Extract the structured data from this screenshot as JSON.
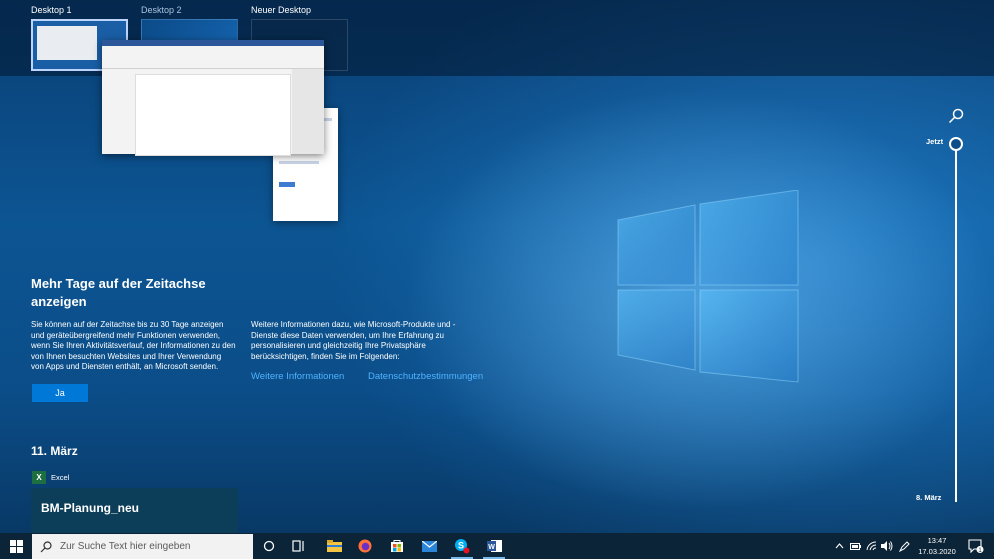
{
  "desktops": [
    {
      "label": "Desktop 1"
    },
    {
      "label": "Desktop 2"
    },
    {
      "label": "Neuer Desktop"
    }
  ],
  "timeline_prompt": {
    "title": "Mehr Tage auf der Zeitachse anzeigen",
    "description": "Sie können auf der Zeitachse bis zu 30 Tage anzeigen und geräteübergreifend mehr Funktionen verwenden, wenn Sie Ihren Aktivitätsverlauf, der Informationen zu den von Ihnen besuchten Websites und Ihrer Verwendung von Apps und Diensten enthält, an Microsoft senden.",
    "info": "Weitere Informationen dazu, wie Microsoft-Produkte und -Dienste diese Daten verwenden, um Ihre Erfahrung zu personalisieren und gleichzeitig Ihre Privatsphäre berücksichtigen, finden Sie im Folgenden:",
    "yes_label": "Ja",
    "more_info_link": "Weitere Informationen",
    "privacy_link": "Datenschutzbestimmungen"
  },
  "day_section": {
    "heading": "11. März",
    "app_name": "Excel",
    "activity_title": "BM-Planung_neu"
  },
  "timeline": {
    "now_label": "Jetzt",
    "end_label": "8. März"
  },
  "taskbar": {
    "search_placeholder": "Zur Suche Text hier eingeben",
    "time": "13:47",
    "date": "17.03.2020",
    "notification_count": "1",
    "icons": [
      "cortana-icon",
      "task-view-icon",
      "file-explorer-icon",
      "firefox-icon",
      "store-icon",
      "mail-icon",
      "skype-icon",
      "word-icon"
    ]
  },
  "colors": {
    "accent": "#0078d7",
    "link": "#4fb3ff",
    "excel": "#1d6f42",
    "word": "#2b579a"
  }
}
